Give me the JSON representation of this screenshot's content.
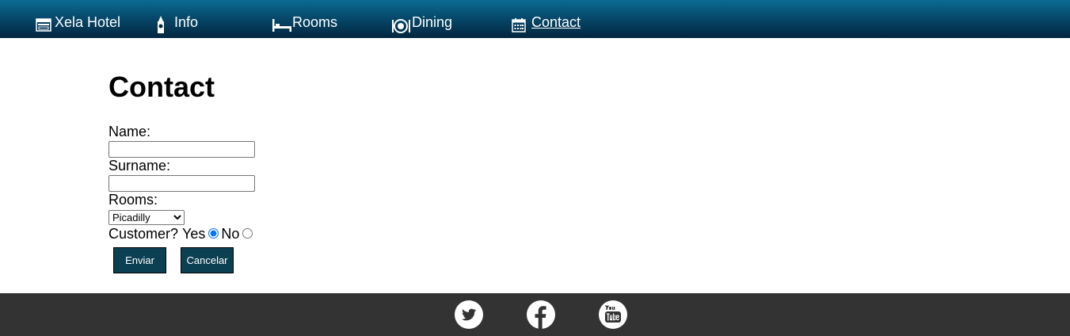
{
  "nav": {
    "items": [
      {
        "label": "Xela Hotel",
        "icon": "hotel-icon"
      },
      {
        "label": "Info",
        "icon": "big-ben-icon"
      },
      {
        "label": "Rooms",
        "icon": "bed-icon"
      },
      {
        "label": "Dining",
        "icon": "plate-icon"
      },
      {
        "label": "Contact",
        "icon": "calendar-icon",
        "active": true
      }
    ]
  },
  "page": {
    "title": "Contact"
  },
  "form": {
    "name_label": "Name:",
    "surname_label": "Surname:",
    "rooms_label": "Rooms:",
    "rooms_selected": "Picadilly",
    "customer_label": "Customer?",
    "yes_label": "Yes",
    "no_label": "No",
    "customer_selected": "Yes",
    "submit_label": "Enviar",
    "cancel_label": "Cancelar"
  },
  "footer": {
    "social": [
      "twitter-icon",
      "facebook-icon",
      "youtube-icon"
    ]
  },
  "colors": {
    "nav_top": "#0b6b92",
    "nav_bottom": "#03263f",
    "button_bg": "#0b3f52",
    "footer_bg": "#333333"
  }
}
